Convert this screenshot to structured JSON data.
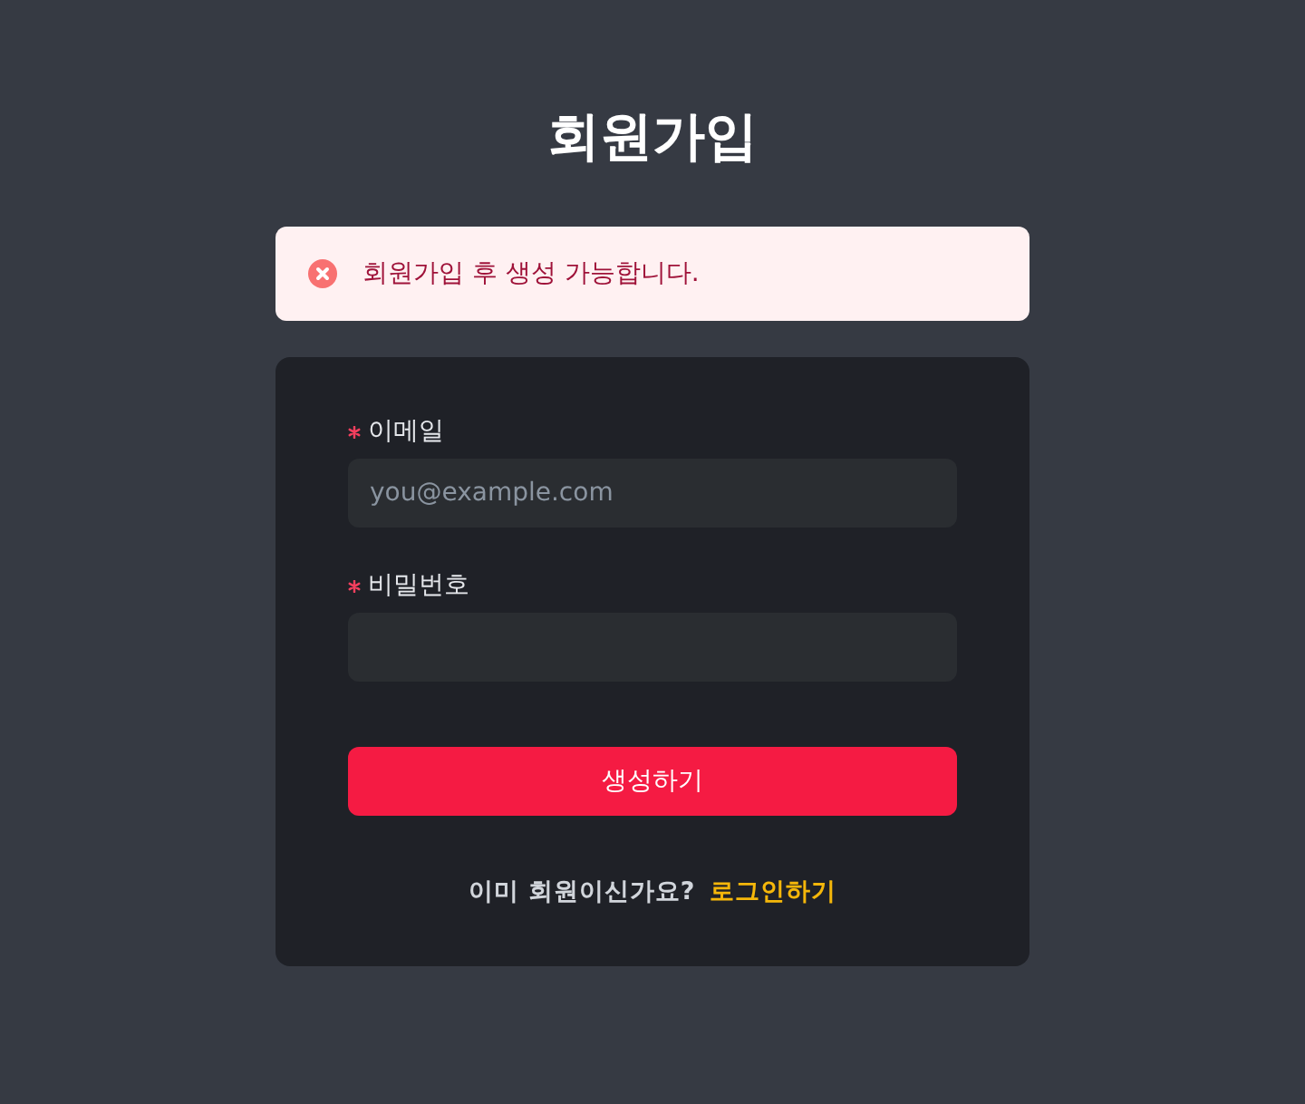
{
  "page": {
    "title": "회원가입"
  },
  "alert": {
    "kind": "error",
    "message": "회원가입 후 생성 가능합니다."
  },
  "form": {
    "fields": [
      {
        "label": "이메일",
        "required": true,
        "placeholder": "you@example.com"
      },
      {
        "label": "비밀번호",
        "required": true
      }
    ],
    "submit": "생성하기"
  },
  "footer": {
    "prompt": "이미 회원이신가요?",
    "link": "로그인하기"
  }
}
